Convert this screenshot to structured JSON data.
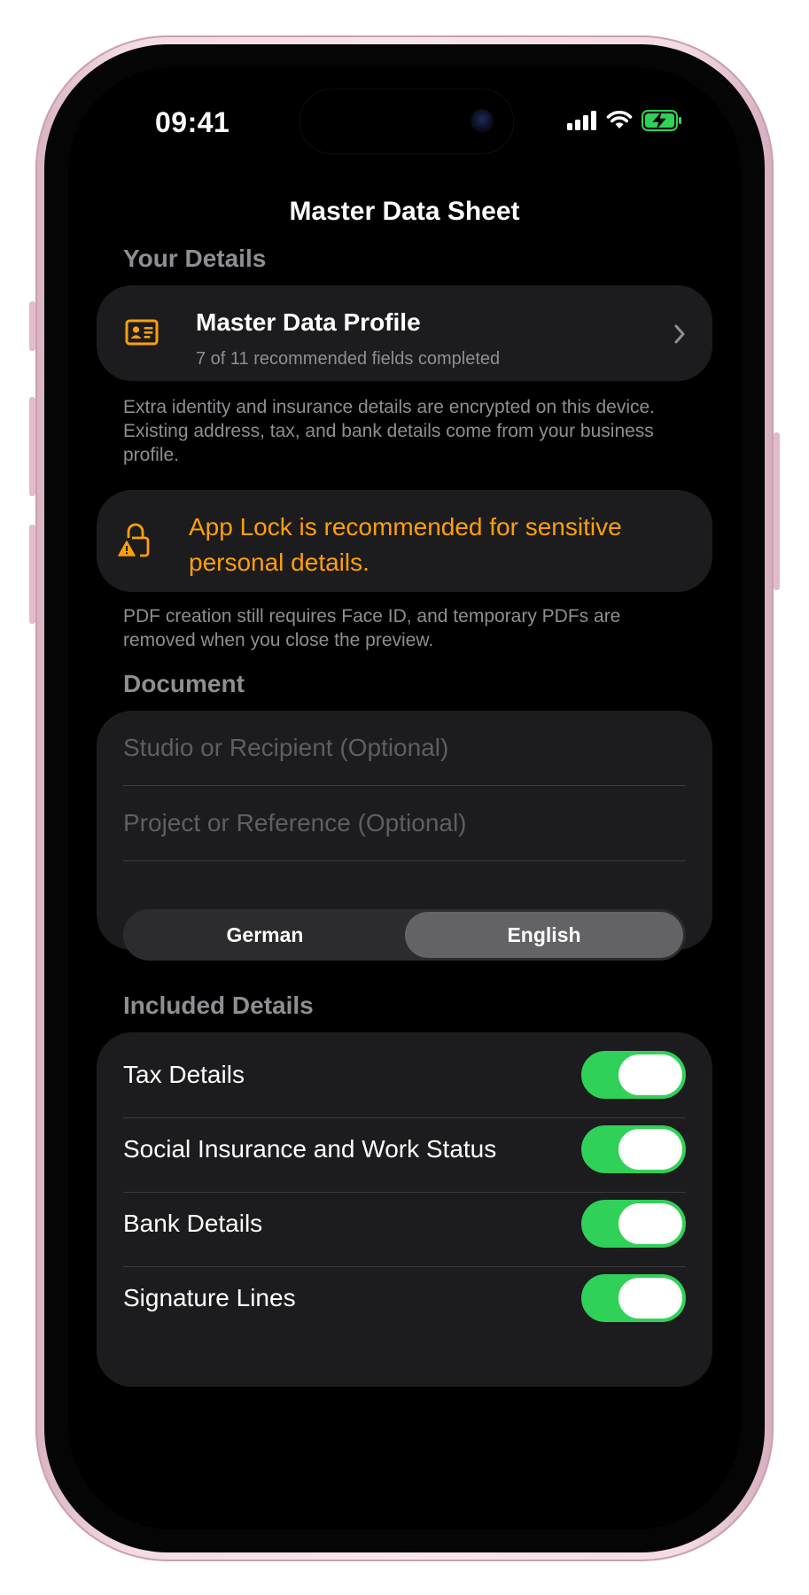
{
  "status_bar": {
    "time": "09:41"
  },
  "nav": {
    "title": "Master Data Sheet"
  },
  "your_details": {
    "header": "Your Details",
    "profile": {
      "title": "Master Data Profile",
      "subtitle": "7 of 11 recommended fields completed",
      "icon": "id-card-icon"
    },
    "footnote": "Extra identity and insurance details are encrypted on this device. Existing address, tax, and bank details come from your business profile."
  },
  "app_lock": {
    "message": "App Lock is recommended for sensitive personal details.",
    "icon": "lock-warning-icon",
    "footnote": "PDF creation still requires Face ID, and temporary PDFs are removed when you close the preview."
  },
  "document": {
    "header": "Document",
    "studio_placeholder": "Studio or Recipient (Optional)",
    "project_placeholder": "Project or Reference (Optional)",
    "language_options": [
      "German",
      "English"
    ],
    "selected_language": "English"
  },
  "included_details": {
    "header": "Included Details",
    "items": [
      {
        "label": "Tax Details",
        "on": true
      },
      {
        "label": "Social Insurance and Work Status",
        "on": true
      },
      {
        "label": "Bank Details",
        "on": true
      },
      {
        "label": "Signature Lines",
        "on": true
      }
    ]
  },
  "colors": {
    "accent": "#ff9f0a",
    "toggle_on": "#30d158",
    "card_bg": "#1c1c1e",
    "secondary_text": "#8e8e93",
    "frame": "#f3dbe4"
  }
}
